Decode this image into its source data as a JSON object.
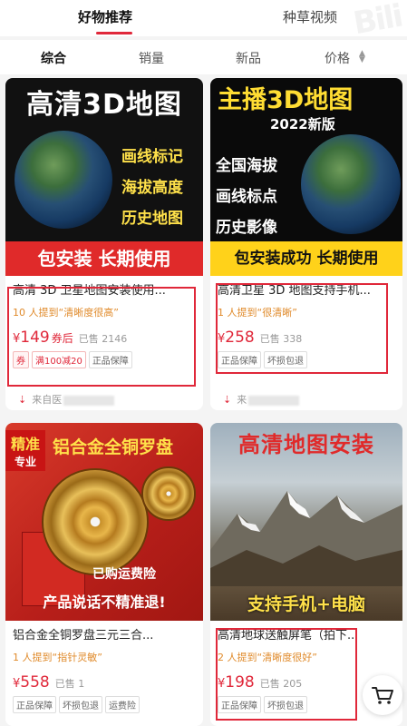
{
  "top_tabs": [
    {
      "label": "好物推荐",
      "active": true
    },
    {
      "label": "种草视频",
      "active": false
    }
  ],
  "watermark": "Bili",
  "sort_bar": {
    "items": [
      "综合",
      "销量",
      "新品",
      "价格"
    ],
    "active": "综合"
  },
  "products": [
    {
      "image": {
        "title": "高清3D地图",
        "features": [
          "画线标记",
          "海拔高度",
          "历史地图"
        ],
        "banner": "包安装  长期使用"
      },
      "name": "高清 3D 卫星地图安装使用...",
      "mention": "10 人提到“清晰度很高”",
      "price": "149",
      "price_suffix": "券后",
      "sold": "已售 2146",
      "tags": [
        "券",
        "满100减20",
        "正品保障"
      ],
      "source": "来自医"
    },
    {
      "image": {
        "title": "主播3D地图",
        "subtitle": "2022新版",
        "features": [
          "全国海拔",
          "画线标点",
          "历史影像"
        ],
        "banner": "包安装成功  长期使用"
      },
      "name": "高清卫星 3D 地图支持手机...",
      "mention": "1 人提到“很清晰”",
      "price": "258",
      "sold": "已售 338",
      "tags": [
        "正品保障",
        "坏损包退"
      ],
      "source": "来"
    },
    {
      "image": {
        "tag_top": "精准",
        "tag_bottom": "专业",
        "title": "铝合金全铜罗盘",
        "shipping": "已购运费险",
        "slogan": "产品说话不精准退!"
      },
      "name": "铝合金全铜罗盘三元三合...",
      "mention": "1 人提到“指针灵敏”",
      "price": "558",
      "sold": "已售 1",
      "tags": [
        "正品保障",
        "坏损包退",
        "运费险"
      ]
    },
    {
      "image": {
        "title": "高清地图安装",
        "support": "支持手机+电脑"
      },
      "name": "高清地球送触屏笔（拍下...",
      "mention": "2 人提到“清晰度很好”",
      "price": "198",
      "sold": "已售 205",
      "tags": [
        "正品保障",
        "坏损包退"
      ]
    }
  ],
  "currency_symbol": "¥",
  "cart_icon": "cart-icon",
  "colors": {
    "accent": "#e0283a",
    "mention": "#e08a2a"
  }
}
